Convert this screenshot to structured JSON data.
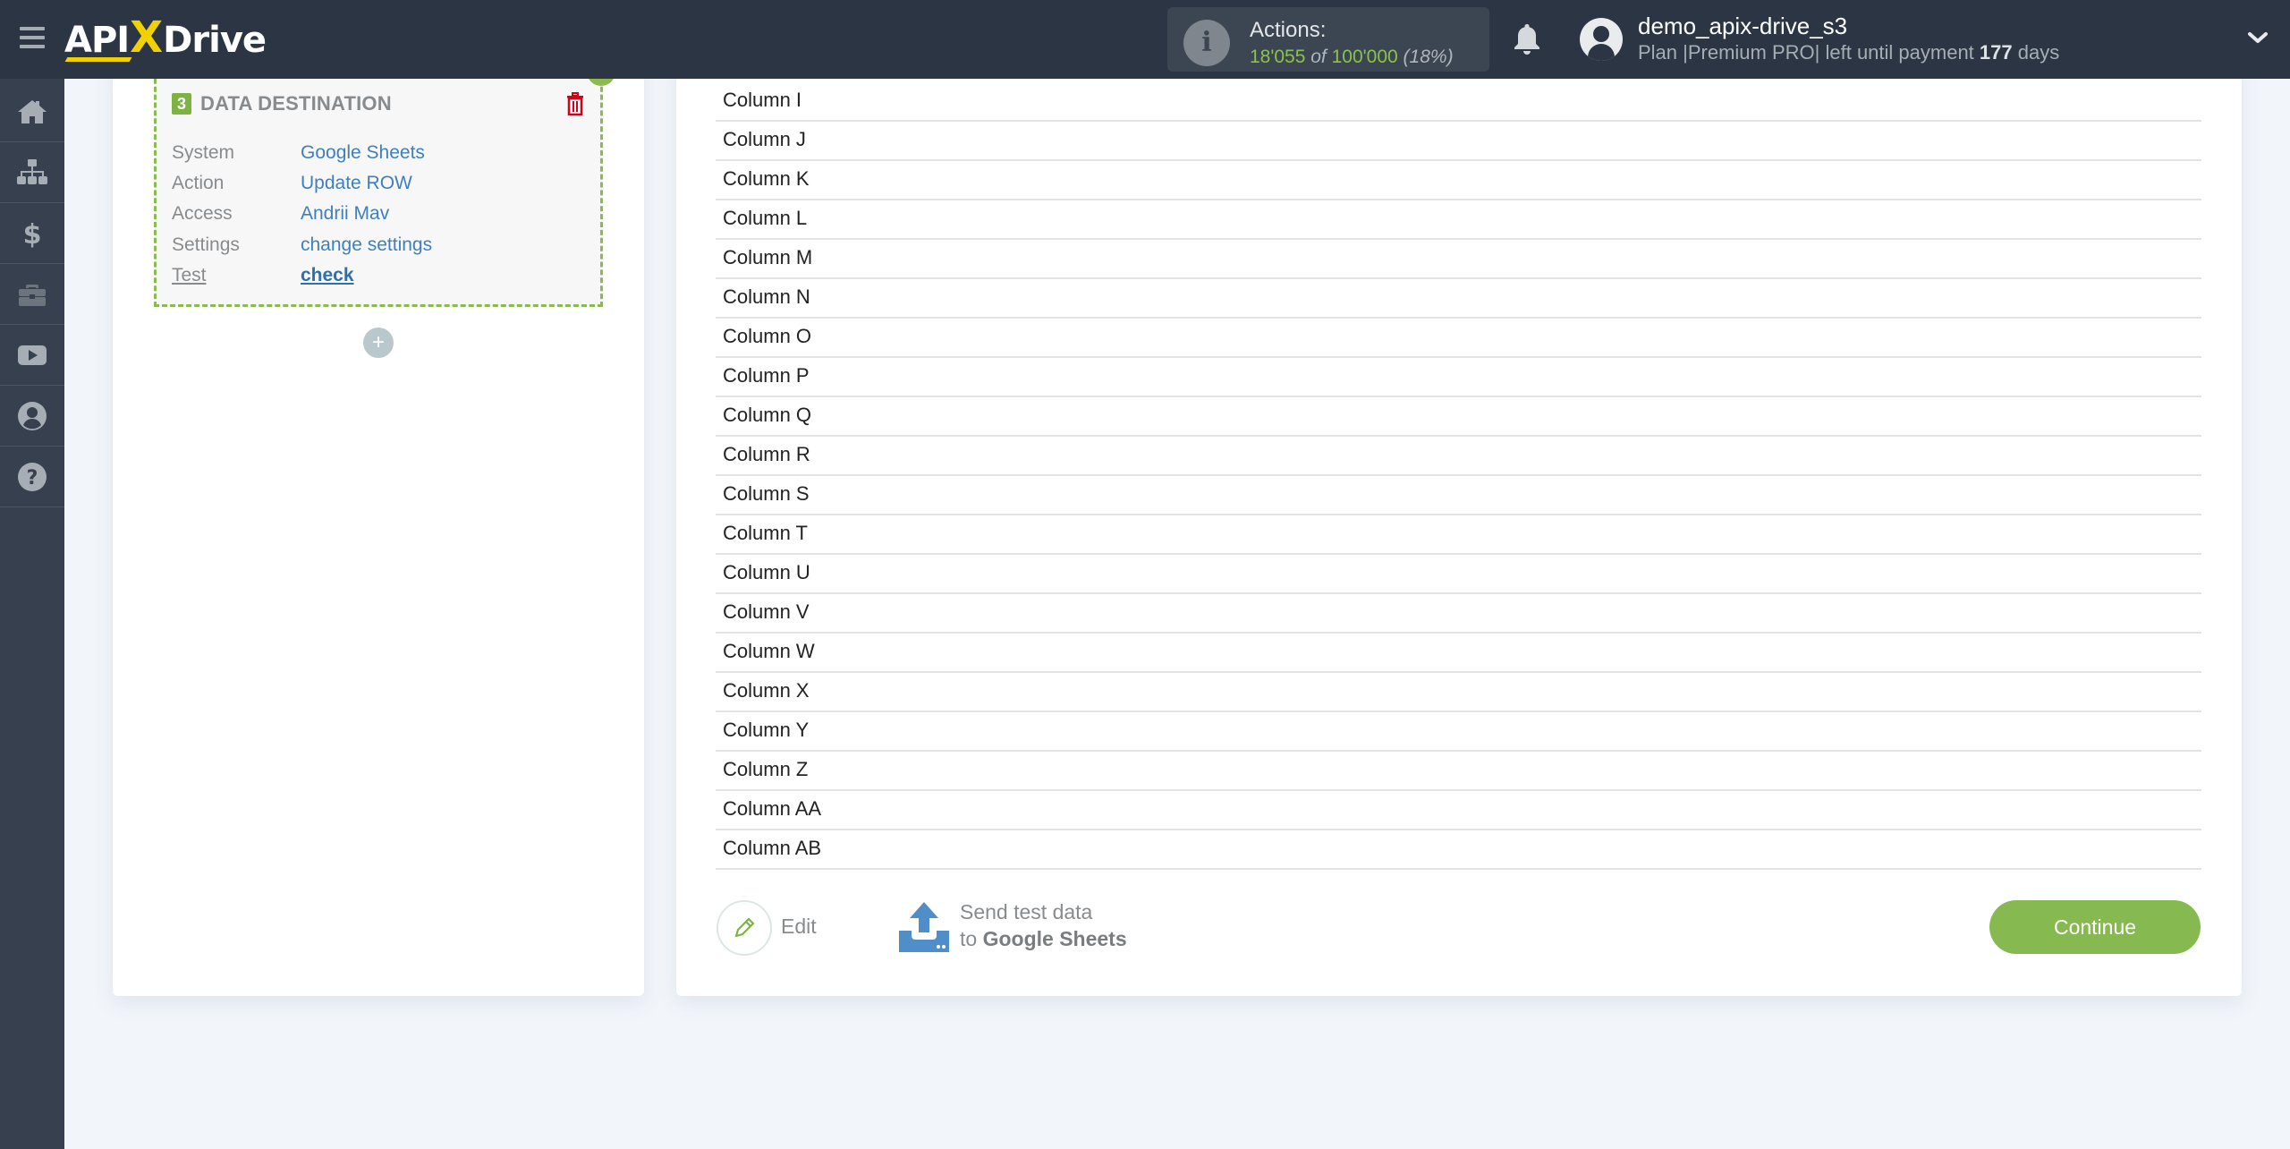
{
  "header": {
    "logo": {
      "api": "API",
      "x": "X",
      "drive": "Drive"
    },
    "actions": {
      "label": "Actions:",
      "used": "18'055",
      "of": "of",
      "total": "100'000",
      "percent": "(18%)"
    },
    "user": {
      "name": "demo_apix-drive_s3",
      "plan_prefix": "Plan |Premium PRO| left until payment",
      "days": "177",
      "days_suffix": "days"
    }
  },
  "sidebar": {
    "items": [
      {
        "icon": "home-icon"
      },
      {
        "icon": "sitemap-icon"
      },
      {
        "icon": "dollar-icon"
      },
      {
        "icon": "briefcase-icon"
      },
      {
        "icon": "youtube-icon"
      },
      {
        "icon": "user-icon"
      },
      {
        "icon": "help-icon"
      }
    ]
  },
  "destination": {
    "step": "3",
    "title": "DATA DESTINATION",
    "fields": [
      {
        "label": "System",
        "value": "Google Sheets"
      },
      {
        "label": "Action",
        "value": "Update ROW"
      },
      {
        "label": "Access",
        "value": "Andrii Mav"
      },
      {
        "label": "Settings",
        "value": "change settings"
      },
      {
        "label": "Test",
        "value": "check"
      }
    ],
    "add_label": "+"
  },
  "columns": [
    "Column I",
    "Column J",
    "Column K",
    "Column L",
    "Column M",
    "Column N",
    "Column O",
    "Column P",
    "Column Q",
    "Column R",
    "Column S",
    "Column T",
    "Column U",
    "Column V",
    "Column W",
    "Column X",
    "Column Y",
    "Column Z",
    "Column AA",
    "Column AB"
  ],
  "footer": {
    "edit": "Edit",
    "send_line1": "Send test data",
    "send_to": "to",
    "send_target": "Google Sheets",
    "continue": "Continue"
  },
  "colors": {
    "header_bg": "#2c3543",
    "sidebar_bg": "#36404e",
    "accent_green": "#86b94f",
    "link_blue": "#3f7fbf",
    "delete_red": "#d0021b"
  }
}
